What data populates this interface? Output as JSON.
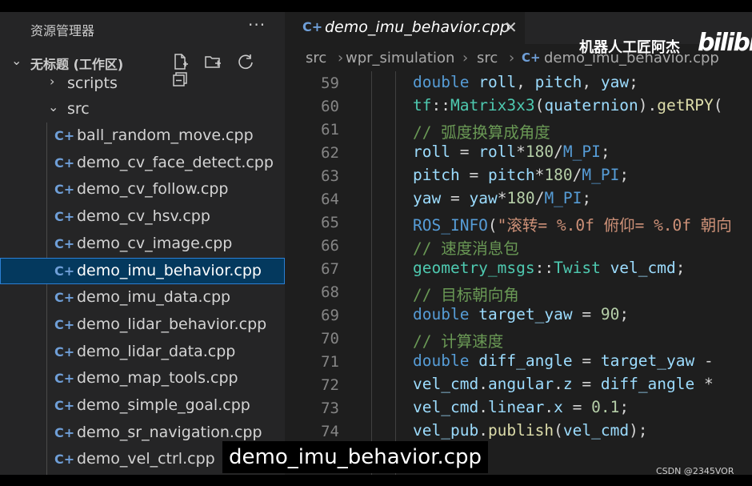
{
  "sidebar": {
    "title": "资源管理器",
    "more": "···",
    "workspace": "无标题 (工作区)",
    "workspace_chevron": "⌄",
    "folders": {
      "scripts": "scripts",
      "src": "src"
    },
    "file_icon": "C+",
    "files": [
      "ball_random_move.cpp",
      "demo_cv_face_detect.cpp",
      "demo_cv_follow.cpp",
      "demo_cv_hsv.cpp",
      "demo_cv_image.cpp",
      "demo_imu_behavior.cpp",
      "demo_imu_data.cpp",
      "demo_lidar_behavior.cpp",
      "demo_lidar_data.cpp",
      "demo_map_tools.cpp",
      "demo_simple_goal.cpp",
      "demo_sr_navigation.cpp",
      "demo_vel_ctrl.cpp"
    ],
    "selected_index": 5
  },
  "tab": {
    "icon": "C+",
    "label": "demo_imu_behavior.cpp",
    "close": "✕"
  },
  "breadcrumb": {
    "p1": "src",
    "p2": "wpr_simulation",
    "p3": "src",
    "file": "demo_imu_behavior.cpp",
    "sep": "›"
  },
  "editor": {
    "line_numbers": [
      "59",
      "60",
      "61",
      "62",
      "63",
      "64",
      "65",
      "66",
      "67",
      "68",
      "69",
      "70",
      "71",
      "72",
      "73",
      "74"
    ]
  },
  "overlay": {
    "watermark": "机器人工匠阿杰",
    "logo": "bilibili",
    "subtitle": "demo_imu_behavior.cpp",
    "csdn": "CSDN @2345VOR"
  },
  "colors": {
    "accent": "#2b7fd4",
    "selected_bg": "#04395e",
    "keyword": "#569cd6",
    "type": "#4ec9b0",
    "comment": "#6a9955",
    "string": "#ce9178",
    "number": "#b5cea8"
  }
}
